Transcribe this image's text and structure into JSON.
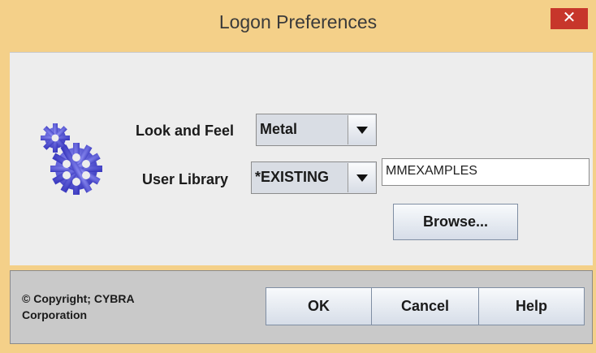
{
  "window": {
    "title": "Logon Preferences",
    "close_glyph": "✕",
    "close_button_color": "#c7362b",
    "frame_color": "#f4d089"
  },
  "icon": {
    "name": "gears-icon",
    "color": "#5a59d6"
  },
  "form": {
    "look_and_feel_label": "Look and Feel",
    "look_and_feel_value": "Metal",
    "user_library_label": "User Library",
    "user_library_value": "*EXISTING",
    "library_name_value": "MMEXAMPLES",
    "browse_label": "Browse..."
  },
  "footer": {
    "copyright_line1": "© Copyright; CYBRA",
    "copyright_line2": "Corporation",
    "ok_label": "OK",
    "cancel_label": "Cancel",
    "help_label": "Help"
  }
}
